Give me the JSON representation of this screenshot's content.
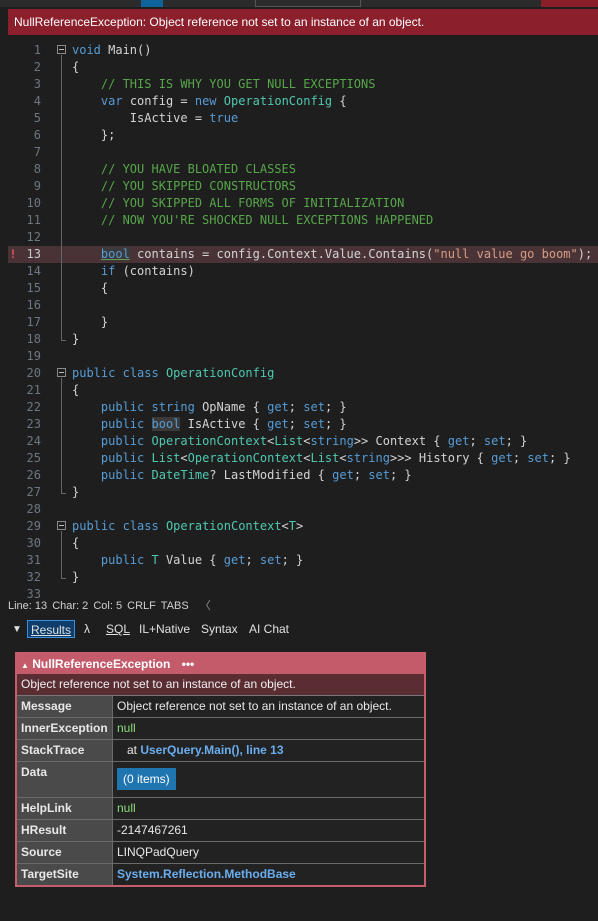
{
  "error_banner": "NullReferenceException: Object reference not set to an instance of an object.",
  "editor": {
    "lines": [
      {
        "n": "1",
        "html": "<span class='kw'>void</span> Main()"
      },
      {
        "n": "2",
        "html": "{"
      },
      {
        "n": "3",
        "html": "    <span class='cm'>// THIS IS WHY YOU GET NULL EXCEPTIONS</span>"
      },
      {
        "n": "4",
        "html": "    <span class='kw'>var</span> config = <span class='kw'>new</span> <span class='ty'>OperationConfig</span> {"
      },
      {
        "n": "5",
        "html": "        IsActive = <span class='kw'>true</span>"
      },
      {
        "n": "6",
        "html": "    };"
      },
      {
        "n": "7",
        "html": ""
      },
      {
        "n": "8",
        "html": "    <span class='cm'>// YOU HAVE BLOATED CLASSES</span>"
      },
      {
        "n": "9",
        "html": "    <span class='cm'>// YOU SKIPPED CONSTRUCTORS</span>"
      },
      {
        "n": "10",
        "html": "    <span class='cm'>// YOU SKIPPED ALL FORMS OF INITIALIZATION</span>"
      },
      {
        "n": "11",
        "html": "    <span class='cm'>// NOW YOU'RE SHOCKED NULL EXCEPTIONS HAPPENED</span>"
      },
      {
        "n": "12",
        "html": ""
      },
      {
        "n": "13",
        "html": "    <span class='kw hb ul'>bool</span> contains = config.Context.Value.Contains(<span class='st'>\"null value go boom\"</span>);"
      },
      {
        "n": "14",
        "html": "    <span class='kw'>if</span> (contains)"
      },
      {
        "n": "15",
        "html": "    {"
      },
      {
        "n": "16",
        "html": ""
      },
      {
        "n": "17",
        "html": "    }"
      },
      {
        "n": "18",
        "html": "}"
      },
      {
        "n": "19",
        "html": ""
      },
      {
        "n": "20",
        "html": "<span class='kw'>public</span> <span class='kw'>class</span> <span class='ty'>OperationConfig</span>"
      },
      {
        "n": "21",
        "html": "{"
      },
      {
        "n": "22",
        "html": "    <span class='kw'>public</span> <span class='kw'>string</span> OpName { <span class='kw'>get</span>; <span class='kw'>set</span>; }"
      },
      {
        "n": "23",
        "html": "    <span class='kw'>public</span> <span class='kw hb'>bool</span> IsActive { <span class='kw'>get</span>; <span class='kw'>set</span>; }"
      },
      {
        "n": "24",
        "html": "    <span class='kw'>public</span> <span class='ty'>OperationContext</span>&lt;<span class='ty'>List</span>&lt;<span class='kw'>string</span>&gt;&gt; Context { <span class='kw'>get</span>; <span class='kw'>set</span>; }"
      },
      {
        "n": "25",
        "html": "    <span class='kw'>public</span> <span class='ty'>List</span>&lt;<span class='ty'>OperationContext</span>&lt;<span class='ty'>List</span>&lt;<span class='kw'>string</span>&gt;&gt;&gt; History { <span class='kw'>get</span>; <span class='kw'>set</span>; }"
      },
      {
        "n": "26",
        "html": "    <span class='kw'>public</span> <span class='ty'>DateTime</span>? LastModified { <span class='kw'>get</span>; <span class='kw'>set</span>; }"
      },
      {
        "n": "27",
        "html": "}"
      },
      {
        "n": "28",
        "html": ""
      },
      {
        "n": "29",
        "html": "<span class='kw'>public</span> <span class='kw'>class</span> <span class='ty'>OperationContext</span>&lt;<span class='ty'>T</span>&gt;"
      },
      {
        "n": "30",
        "html": "{"
      },
      {
        "n": "31",
        "html": "    <span class='kw'>public</span> <span class='ty'>T</span> Value { <span class='kw'>get</span>; <span class='kw'>set</span>; }"
      },
      {
        "n": "32",
        "html": "}"
      },
      {
        "n": "33",
        "html": ""
      }
    ],
    "breakpoint_marker": "!"
  },
  "status": {
    "line": "Line: 13",
    "char": "Char: 2",
    "col": "Col: 5",
    "eol": "CRLF",
    "indent": "TABS",
    "arrow": "〈"
  },
  "tabs": {
    "collapse": "▼",
    "results": "Results",
    "lambda": "λ",
    "sql": "SQL",
    "il": "IL+Native",
    "syntax": "Syntax",
    "ai": "AI Chat"
  },
  "exception": {
    "title": "NullReferenceException",
    "menu": "•••",
    "message": "Object reference not set to an instance of an object.",
    "rows": {
      "message": {
        "key": "Message",
        "value": "Object reference not set to an instance of an object."
      },
      "inner": {
        "key": "InnerException",
        "value": "null"
      },
      "stack": {
        "key": "StackTrace",
        "prefix": "   at ",
        "link": "UserQuery.Main(), line 13"
      },
      "data": {
        "key": "Data",
        "value": "(0 items)"
      },
      "helplink": {
        "key": "HelpLink",
        "value": "null"
      },
      "hresult": {
        "key": "HResult",
        "value": "-2147467261"
      },
      "source": {
        "key": "Source",
        "value": "LINQPadQuery"
      },
      "target": {
        "key": "TargetSite",
        "value": "System.Reflection.MethodBase"
      }
    }
  }
}
